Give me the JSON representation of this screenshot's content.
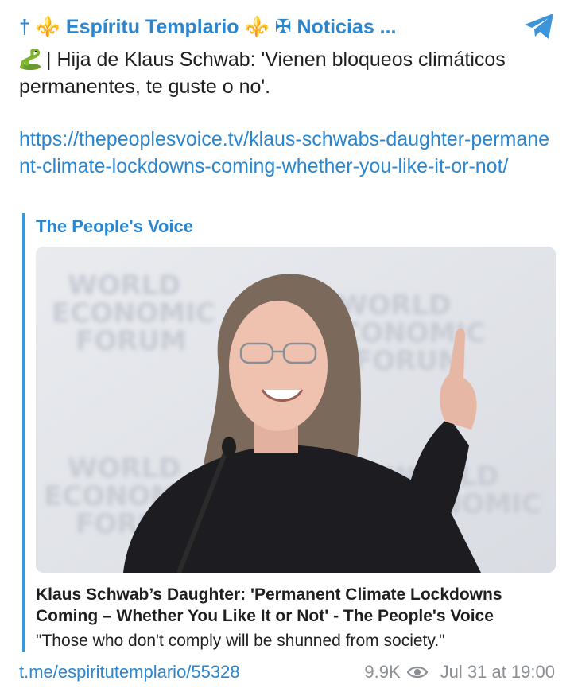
{
  "channel": {
    "title": "† ⚜️ Espíritu Templario ⚜️ ✠ Noticias ..."
  },
  "message": {
    "text": "| Hija de Klaus Schwab: 'Vienen bloqueos climáticos permanentes, te guste o no'.",
    "link": "https://thepeoplesvoice.tv/klaus-schwabs-daughter-permanent-climate-lockdowns-coming-whether-you-like-it-or-not/"
  },
  "preview": {
    "site_name": "The People's Voice",
    "headline": "Klaus Schwab’s Daughter: 'Permanent Climate Lockdowns Coming – Whether You Like It or Not' - The People's Voice",
    "description": "\"Those who don't comply will be shunned from society.\"",
    "image_icon": "photo-woman-speaking-at-podium"
  },
  "footer": {
    "post_link": "t.me/espiritutemplario/55328",
    "views": "9.9K",
    "timestamp": "Jul 31 at 19:00"
  },
  "colors": {
    "accent": "#2a86cf",
    "quote_bar": "#3d95d9",
    "meta_gray": "#8b8f94"
  }
}
